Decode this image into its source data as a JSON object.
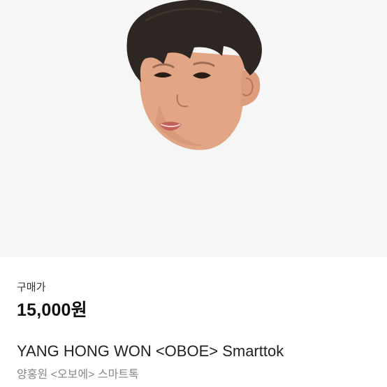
{
  "product": {
    "image_alt": "child face smarttok",
    "price_label": "구매가",
    "price": "15,000원",
    "title": "YANG HONG WON <OBOE> Smarttok",
    "subtitle": "양홍원 <오보에> 스마트톡"
  }
}
